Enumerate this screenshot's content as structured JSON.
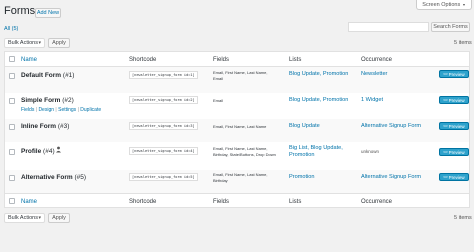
{
  "header": {
    "title": "Forms",
    "add_new": "Add New",
    "screen_options": "Screen Options",
    "screen_options_arrow": "▼"
  },
  "filter": {
    "all_label": "All (5)"
  },
  "search": {
    "placeholder": "",
    "button": "Search Forms"
  },
  "bulk": {
    "top": {
      "select": "Bulk Actions",
      "apply": "Apply"
    },
    "bottom": {
      "select": "Bulk Actions",
      "apply": "Apply"
    }
  },
  "pagination": {
    "top": "5 items",
    "bottom": "5 items"
  },
  "columns": [
    "Name",
    "Shortcode",
    "Fields",
    "Lists",
    "Occurrence"
  ],
  "rows": [
    {
      "name": "Default Form",
      "id": "(#1)",
      "shortcode": "[newsletter_signup_form id=1]",
      "fields": "Email, First Name, Last Name,",
      "fields2": "Email",
      "lists": "Blog Update, Promotion",
      "occurrence": "Newsletter",
      "preview": "Preview"
    },
    {
      "name": "Simple Form",
      "id": "(#2)",
      "shortcode": "[newsletter_signup_form id=2]",
      "fields": "Email",
      "lists": "Blog Update, Promotion",
      "occurrence": "1 Widget",
      "preview": "Preview",
      "actions": [
        "Fields",
        "Design",
        "Settings",
        "Duplicate"
      ]
    },
    {
      "name": "Inline Form",
      "id": "(#3)",
      "shortcode": "[newsletter_signup_form id=3]",
      "fields": "Email, First Name, Last Name",
      "lists": "Blog Update",
      "occurrence": "Alternative Signup Form",
      "preview": "Preview"
    },
    {
      "name": "Profile",
      "id": "(#4)",
      "icon": "users-icon",
      "shortcode": "[newsletter_signup_form id=4]",
      "fields": "Email, First Name, Last Name,",
      "fields2": "Birthday, State/Buttons, Drop Down",
      "lists": "Big List, Blog Update,",
      "lists2": "Promotion",
      "occurrence": "unknown",
      "preview": "Preview"
    },
    {
      "name": "Alternative Form",
      "id": "(#5)",
      "shortcode": "[newsletter_signup_form id=5]",
      "fields": "Email, First Name, Last Name,",
      "fields2": "Birthday",
      "lists": "Promotion",
      "occurrence": "Alternative Signup Form",
      "preview": "Preview"
    }
  ],
  "colors": {
    "link": "#0073aa",
    "preview_button": "#2ea2cc",
    "background": "#f1f1f1"
  }
}
